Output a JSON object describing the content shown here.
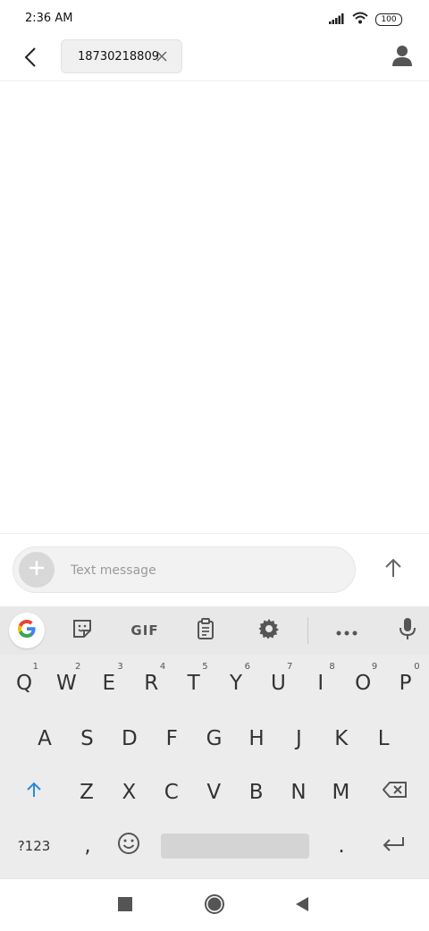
{
  "status_bar": {
    "time": "2:36 AM",
    "battery": "100",
    "icons": [
      "signal-icon",
      "wifi-icon",
      "battery-icon"
    ]
  },
  "header": {
    "recipient": "18730218809",
    "icons": [
      "back-arrow-icon",
      "close-icon",
      "contact-person-icon"
    ]
  },
  "composer": {
    "placeholder": "Text message",
    "icons": [
      "plus-icon",
      "send-arrow-icon"
    ]
  },
  "keyboard": {
    "toolbar": [
      "google-icon",
      "sticker-icon",
      "gif-button",
      "clipboard-icon",
      "settings-icon",
      "more-icon",
      "mic-icon"
    ],
    "gif_label": "GIF",
    "row1": [
      {
        "k": "Q",
        "h": "1"
      },
      {
        "k": "W",
        "h": "2"
      },
      {
        "k": "E",
        "h": "3"
      },
      {
        "k": "R",
        "h": "4"
      },
      {
        "k": "T",
        "h": "5"
      },
      {
        "k": "Y",
        "h": "6"
      },
      {
        "k": "U",
        "h": "7"
      },
      {
        "k": "I",
        "h": "8"
      },
      {
        "k": "O",
        "h": "9"
      },
      {
        "k": "P",
        "h": "0"
      }
    ],
    "row2": [
      "A",
      "S",
      "D",
      "F",
      "G",
      "H",
      "J",
      "K",
      "L"
    ],
    "row3": [
      "Z",
      "X",
      "C",
      "V",
      "B",
      "N",
      "M"
    ],
    "symbols_label": "?123",
    "comma": ",",
    "period": "."
  },
  "nav_bar": {
    "icons": [
      "recent-apps-icon",
      "home-icon",
      "back-triangle-icon"
    ]
  }
}
